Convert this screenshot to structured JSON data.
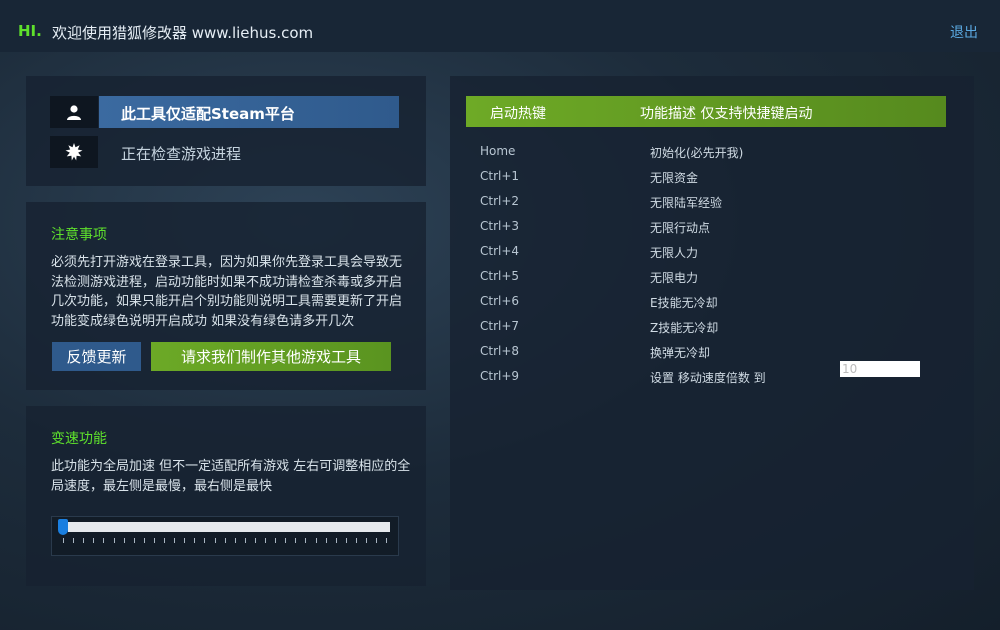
{
  "header": {
    "hi": "HI.",
    "welcome": "欢迎使用猎狐修改器 www.liehus.com",
    "logout": "退出"
  },
  "platform": {
    "label": "此工具仅适配Steam平台",
    "status": "正在检查游戏进程"
  },
  "notes": {
    "title": "注意事项",
    "body": "必须先打开游戏在登录工具，因为如果你先登录工具会导致无法检测游戏进程，启动功能时如果不成功请检查杀毒或多开启几次功能，如果只能开启个别功能则说明工具需要更新了开启功能变成绿色说明开启成功 如果没有绿色请多开几次",
    "feedback_label": "反馈更新",
    "request_label": "请求我们制作其他游戏工具"
  },
  "speed": {
    "title": "变速功能",
    "body": "此功能为全局加速 但不一定适配所有游戏 左右可调整相应的全局速度，最左侧是最慢，最右侧是最快",
    "value": 0
  },
  "hotkeys": {
    "col_key": "启动热键",
    "col_desc": "功能描述 仅支持快捷键启动",
    "rows": [
      {
        "key": "Home",
        "desc": "初始化(必先开我)"
      },
      {
        "key": "Ctrl+1",
        "desc": "无限资金"
      },
      {
        "key": "Ctrl+2",
        "desc": "无限陆军经验"
      },
      {
        "key": "Ctrl+3",
        "desc": "无限行动点"
      },
      {
        "key": "Ctrl+4",
        "desc": "无限人力"
      },
      {
        "key": "Ctrl+5",
        "desc": "无限电力"
      },
      {
        "key": "Ctrl+6",
        "desc": "E技能无冷却"
      },
      {
        "key": "Ctrl+7",
        "desc": "Z技能无冷却"
      },
      {
        "key": "Ctrl+8",
        "desc": "换弹无冷却"
      },
      {
        "key": "Ctrl+9",
        "desc": "设置 移动速度倍数 到",
        "input_value": "10"
      }
    ]
  },
  "colors": {
    "accent_green": "#5ee02c",
    "button_blue": "#2f5a8c",
    "header_green": "#6eaa26"
  }
}
